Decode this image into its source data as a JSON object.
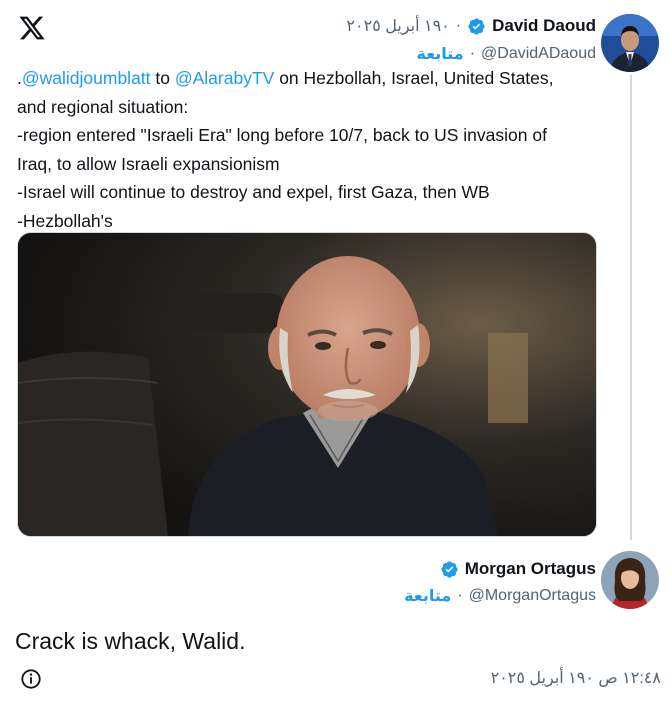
{
  "logo": {
    "icon": "x-logo-icon"
  },
  "tweet": {
    "author": {
      "name": "David Daoud",
      "handle": "@DavidADaoud",
      "date": "١٩٠ أبريل ٢٠٢٥",
      "follow_label": "متابعة",
      "separator": "·",
      "verified_color": "#1d9bf0"
    },
    "text": {
      "prefix": ".",
      "mention1": "@walidjoumblatt",
      "word_to": " to ",
      "mention2": "@AlarabyTV",
      "line1_rest": " on Hezbollah, Israel, United States,",
      "line2": "and regional situation:",
      "line3": "-region entered \"Israeli Era\" long before 10/7, back to US invasion of",
      "line4": "Iraq, to allow Israeli expansionism",
      "line5": "-Israel will continue to destroy and expel, first Gaza, then WB",
      "line6": "-Hezbollah's"
    }
  },
  "reply": {
    "author": {
      "name": "Morgan Ortagus",
      "handle": "@MorganOrtagus",
      "follow_label": "متابعة",
      "separator": "·"
    },
    "text": "Crack is whack, Walid.",
    "timestamp": "١٢:٤٨ ص ١٩٠ أبريل ٢٠٢٥"
  },
  "colors": {
    "accent": "#1d9bf0",
    "secondary_text": "#536471",
    "primary_text": "#0f1419"
  }
}
